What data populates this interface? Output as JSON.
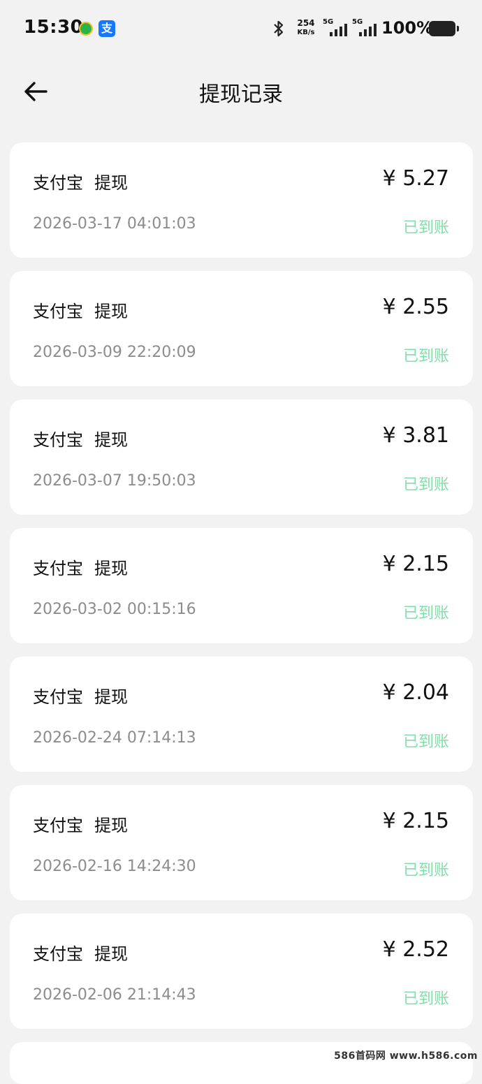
{
  "status_bar": {
    "time": "15:30",
    "app_icon_2_glyph": "支",
    "net_speed_value": "254",
    "net_speed_unit": "KB/s",
    "sim1_type": "5G",
    "sim2_type": "5G",
    "battery": "100%"
  },
  "header": {
    "title": "提现记录",
    "back_icon": "arrow-left-icon"
  },
  "records": [
    {
      "method": "支付宝",
      "action": "提现",
      "amount": "¥ 5.27",
      "time": "2026-03-17 04:01:03",
      "status": "已到账"
    },
    {
      "method": "支付宝",
      "action": "提现",
      "amount": "¥ 2.55",
      "time": "2026-03-09 22:20:09",
      "status": "已到账"
    },
    {
      "method": "支付宝",
      "action": "提现",
      "amount": "¥ 3.81",
      "time": "2026-03-07 19:50:03",
      "status": "已到账"
    },
    {
      "method": "支付宝",
      "action": "提现",
      "amount": "¥ 2.15",
      "time": "2026-03-02 00:15:16",
      "status": "已到账"
    },
    {
      "method": "支付宝",
      "action": "提现",
      "amount": "¥ 2.04",
      "time": "2026-02-24 07:14:13",
      "status": "已到账"
    },
    {
      "method": "支付宝",
      "action": "提现",
      "amount": "¥ 2.15",
      "time": "2026-02-16 14:24:30",
      "status": "已到账"
    },
    {
      "method": "支付宝",
      "action": "提现",
      "amount": "¥ 2.52",
      "time": "2026-02-06 21:14:43",
      "status": "已到账"
    }
  ],
  "watermark": "586首码网 www.h586.com",
  "colors": {
    "background": "#f2f2f2",
    "card": "#ffffff",
    "status_green": "#7fe0a8",
    "time_gray": "#8c8c8c"
  }
}
